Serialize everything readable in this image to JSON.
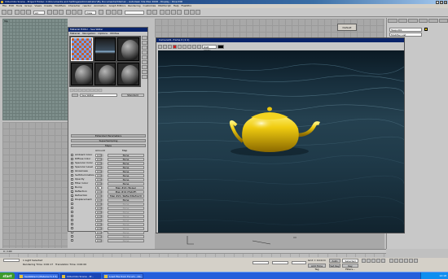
{
  "app": {
    "title": "COLombo Scene - Project Folder: C:\\Documents and Settings\\Administrator\\My Documents\\3dsmax - Autodesk 3ds Max 2008 - Display : Direct3D",
    "window_controls": [
      "_",
      "□",
      "×"
    ]
  },
  "menubar": [
    "File",
    "Edit",
    "Tools",
    "Group",
    "Views",
    "Create",
    "Modifiers",
    "Character",
    "reactor",
    "Animation",
    "Graph Editors",
    "Rendering",
    "Customize",
    "MAXScript",
    "Help",
    "FlashPro"
  ],
  "toolbar": {
    "selection_filter": "All",
    "ref_coord": "View",
    "named_selection": ""
  },
  "viewports": {
    "top_label": "Top",
    "small_button": "Default"
  },
  "command_panel": {
    "object_name": "Teapot01",
    "modifier_list": "Modifier List",
    "swatch_color": "#e3c400"
  },
  "material_editor": {
    "title": "Material Editor - Sea Water",
    "menu": [
      "Material",
      "Navigation",
      "Options",
      "Utilities"
    ],
    "material_name": "Sea Water",
    "material_type": "Standard",
    "rollouts": [
      "Extended Parameters",
      "SuperSampling",
      "Maps",
      "mental ray Connection"
    ],
    "maps_header": {
      "amount": "Amount",
      "map": "Map"
    },
    "maps": [
      {
        "name": "Ambient Color",
        "amount": "100",
        "map": "None",
        "on": false,
        "dim": false
      },
      {
        "name": "Diffuse Color",
        "amount": "100",
        "map": "None",
        "on": false,
        "dim": false
      },
      {
        "name": "Specular Color",
        "amount": "100",
        "map": "None",
        "on": false,
        "dim": false
      },
      {
        "name": "Specular Level",
        "amount": "100",
        "map": "None",
        "on": false,
        "dim": false
      },
      {
        "name": "Glossiness",
        "amount": "100",
        "map": "None",
        "on": false,
        "dim": false
      },
      {
        "name": "Self-Illumination",
        "amount": "100",
        "map": "None",
        "on": false,
        "dim": false
      },
      {
        "name": "Opacity",
        "amount": "100",
        "map": "None",
        "on": false,
        "dim": false
      },
      {
        "name": "Filter Color",
        "amount": "100",
        "map": "None",
        "on": false,
        "dim": false
      },
      {
        "name": "Bump",
        "amount": "30",
        "map": "Map #24 (Noise)",
        "on": true,
        "dim": false
      },
      {
        "name": "Reflection",
        "amount": "100",
        "map": "Map #19 (Falloff)",
        "on": true,
        "dim": false
      },
      {
        "name": "Refraction",
        "amount": "100",
        "map": "Map #21 (Reflect/Refract)",
        "on": true,
        "dim": false
      },
      {
        "name": "Displacement",
        "amount": "100",
        "map": "None",
        "on": false,
        "dim": false
      },
      {
        "name": "",
        "amount": "100",
        "map": "None",
        "on": false,
        "dim": true
      },
      {
        "name": "",
        "amount": "100",
        "map": "None",
        "on": false,
        "dim": true
      },
      {
        "name": "",
        "amount": "100",
        "map": "None",
        "on": false,
        "dim": true
      },
      {
        "name": "",
        "amount": "100",
        "map": "None",
        "on": false,
        "dim": true
      },
      {
        "name": "",
        "amount": "100",
        "map": "None",
        "on": false,
        "dim": true
      },
      {
        "name": "",
        "amount": "100",
        "map": "None",
        "on": false,
        "dim": true
      },
      {
        "name": "",
        "amount": "100",
        "map": "None",
        "on": false,
        "dim": true
      },
      {
        "name": "",
        "amount": "100",
        "map": "None",
        "on": false,
        "dim": true
      },
      {
        "name": "",
        "amount": "100",
        "map": "None",
        "on": false,
        "dim": true
      },
      {
        "name": "",
        "amount": "100",
        "map": "None",
        "on": false,
        "dim": true
      }
    ]
  },
  "render_frame": {
    "title": "Camera01, frame 0 (1:1)",
    "channel": "RGB Alpha",
    "teapot_color": "#e8c000"
  },
  "timeline": {
    "frame": "0 / 100"
  },
  "status": {
    "selection": "1 Light Selected",
    "render_time": "Rendering Time: 0:00:17",
    "translation_time": "Translation Time: 0:00:00",
    "grid": "Grid = 10.0cm",
    "auto_key": "Auto Key",
    "selected": "Selected",
    "set_key": "Set Key",
    "key_filters": "Key Filters...",
    "add_time_tag": "Add Time Tag",
    "x": "",
    "y": "",
    "z": ""
  },
  "taskbar": {
    "start": "start",
    "items": [
      {
        "label": "SeaWater2 [Material 5.3.5] - 3...",
        "active": false
      },
      {
        "label": "COLombo Scene - Pr...",
        "active": true
      },
      {
        "label": "Load File from Forum - Ab...",
        "active": false
      }
    ],
    "clock": "12:18"
  }
}
